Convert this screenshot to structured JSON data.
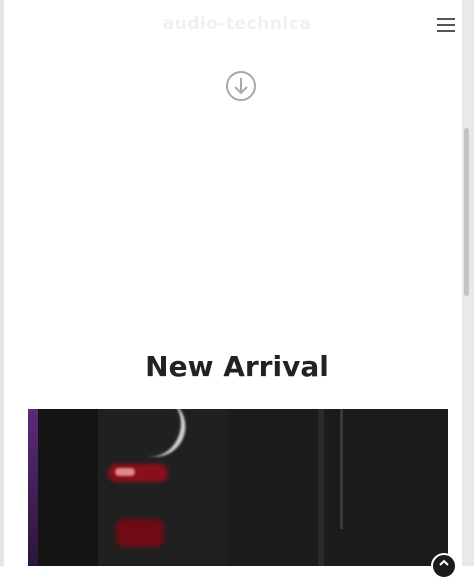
{
  "header": {
    "logo_text": "audio-technica",
    "menu_icon": "hamburger-menu-icon"
  },
  "hero_scroll": {
    "icon": "arrow-down-circle-icon"
  },
  "new_arrival": {
    "title": "New Arrival",
    "image": "product-photo"
  },
  "scroll_top_button": {
    "icon": "chevron-up-icon"
  },
  "colors": {
    "title": "#222222",
    "logo": "#f0f0f0",
    "icon_gray": "#a8a8a8",
    "hero_dark": "#1c1c1e"
  }
}
